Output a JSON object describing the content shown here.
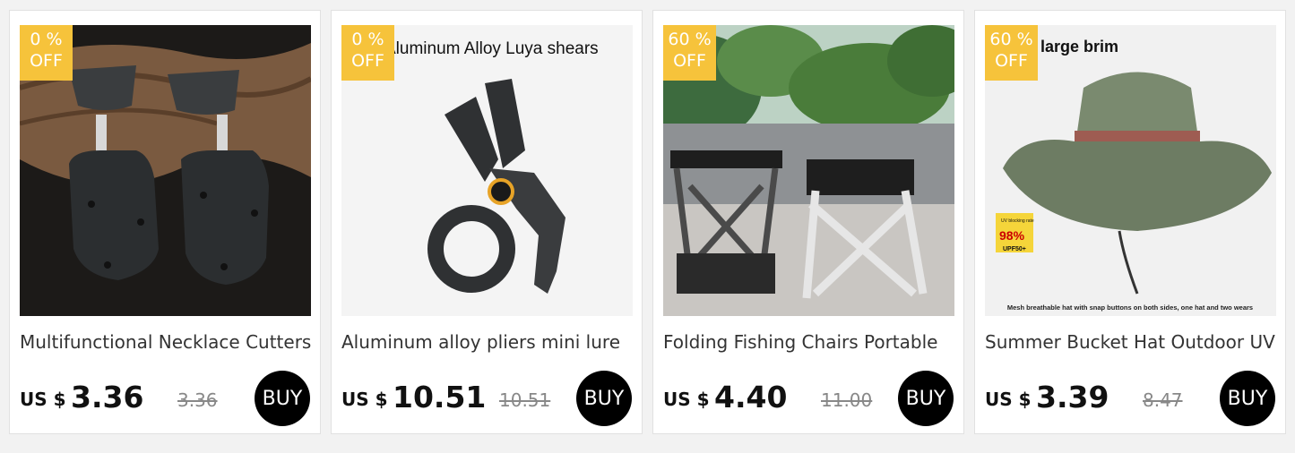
{
  "currency_label": "US $",
  "buy_label": "BUY",
  "products": [
    {
      "discount_value": "0 %",
      "discount_suffix": "OFF",
      "title": "Multifunctional Necklace Cutters",
      "price": "3.36",
      "original_price": "3.36",
      "image_text": ""
    },
    {
      "discount_value": "0 %",
      "discount_suffix": "OFF",
      "title": "Aluminum alloy pliers mini lure",
      "price": "10.51",
      "original_price": "10.51",
      "image_text": "Aluminum Alloy Luya shears"
    },
    {
      "discount_value": "60 %",
      "discount_suffix": "OFF",
      "title": "Folding Fishing Chairs Portable",
      "price": "4.40",
      "original_price": "11.00",
      "image_text": ""
    },
    {
      "discount_value": "60 %",
      "discount_suffix": "OFF",
      "title": "Summer Bucket Hat Outdoor UV",
      "price": "3.39",
      "original_price": "8.47",
      "image_text": "large brim",
      "image_badge_top": "UV blocking rate",
      "image_badge_value": "98%",
      "image_badge_bottom": "UPF50+",
      "image_caption": "Mesh breathable hat with snap buttons on both sides, one hat and two wears"
    }
  ]
}
